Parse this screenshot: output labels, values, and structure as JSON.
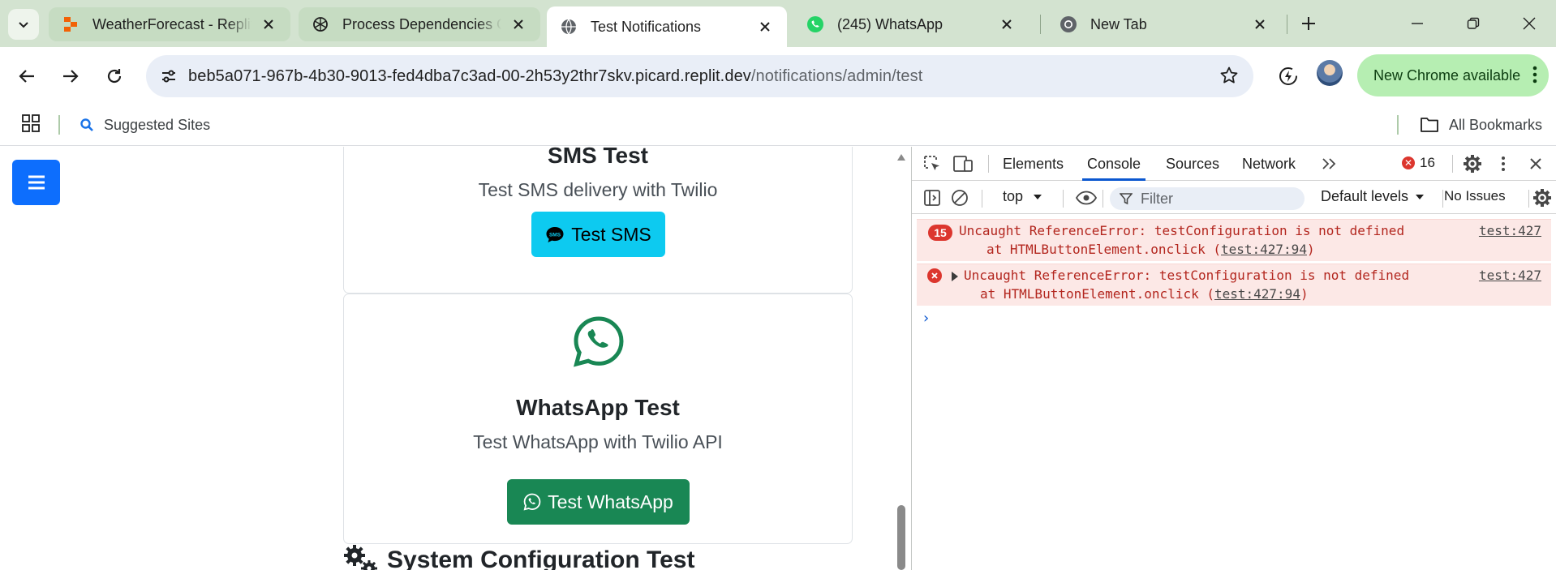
{
  "tabs": [
    {
      "title": "WeatherForecast - Replit",
      "favicon": "replit-icon",
      "state": "inactive"
    },
    {
      "title": "Process Dependencies On",
      "favicon": "openai-icon",
      "state": "inactive"
    },
    {
      "title": "Test Notifications",
      "favicon": "globe-icon",
      "state": "active"
    },
    {
      "title": "(245) WhatsApp",
      "favicon": "whatsapp-icon",
      "state": "plain"
    },
    {
      "title": "New Tab",
      "favicon": "chrome-icon",
      "state": "plain"
    }
  ],
  "toolbar": {
    "url_host": "beb5a071-967b-4b30-9013-fed4dba7c3ad-00-2h53y2thr7skv.picard.replit.dev",
    "url_path": "/notifications/admin/test",
    "update_label": "New Chrome available"
  },
  "bookmarks": {
    "suggested": "Suggested Sites",
    "all": "All Bookmarks"
  },
  "page": {
    "sms_card": {
      "title": "SMS Test",
      "subtitle": "Test SMS delivery with Twilio",
      "button": "Test SMS"
    },
    "whatsapp_card": {
      "title": "WhatsApp Test",
      "subtitle": "Test WhatsApp with Twilio API",
      "button": "Test WhatsApp"
    },
    "section_heading": "System Configuration Test"
  },
  "devtools": {
    "tabs": [
      "Elements",
      "Console",
      "Sources",
      "Network"
    ],
    "active_tab": "Console",
    "error_count": "16",
    "context": "top",
    "filter_placeholder": "Filter",
    "levels": "Default levels",
    "issues": "No Issues",
    "messages": [
      {
        "count": "15",
        "text": "Uncaught ReferenceError: testConfiguration is not defined",
        "stack_prefix": "at HTMLButtonElement.onclick (",
        "stack_link": "test:427:94",
        "stack_suffix": ")",
        "source": "test:427"
      },
      {
        "count": "",
        "text": "Uncaught ReferenceError: testConfiguration is not defined",
        "stack_prefix": "at HTMLButtonElement.onclick (",
        "stack_link": "test:427:94",
        "stack_suffix": ")",
        "source": "test:427"
      }
    ],
    "prompt": "›"
  },
  "colors": {
    "tabstrip": "#d3e3d0",
    "primary": "#0d6efd",
    "info": "#0dcaf0",
    "success": "#198754",
    "error": "#dc362e"
  }
}
